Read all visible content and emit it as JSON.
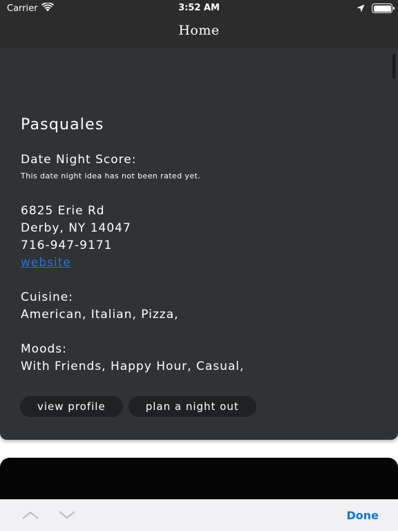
{
  "status_bar": {
    "carrier": "Carrier",
    "time": "3:52 AM",
    "icons": [
      "wifi-icon",
      "location-arrow-icon",
      "battery-icon"
    ],
    "battery_level": 1.0
  },
  "nav": {
    "title": "Home"
  },
  "place": {
    "name": "Pasquales",
    "score_heading": "Date Night Score:",
    "score_text": "This date night idea has not been rated yet.",
    "address_line1": "6825 Erie Rd",
    "address_line2": "Derby, NY 14047",
    "phone": "716-947-9171",
    "website_label": "website",
    "cuisine_label": "Cuisine:",
    "cuisine_value": "American, Italian, Pizza,",
    "moods_label": "Moods:",
    "moods_value": "With Friends, Happy Hour, Casual,"
  },
  "actions": {
    "view_profile": "view profile",
    "plan_night": "plan a night out"
  },
  "toolbar": {
    "done_label": "Done",
    "icons": [
      "chevron-up-icon",
      "chevron-down-icon"
    ]
  },
  "colors": {
    "header_bg": "#2c2c2c",
    "card_bg": "#2f3335",
    "link": "#2d6fe0",
    "done": "#1476d6",
    "toolbar_bg": "#f1f1f3"
  }
}
